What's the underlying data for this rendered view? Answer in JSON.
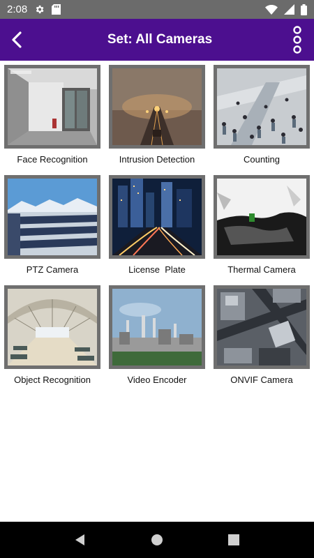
{
  "status_bar": {
    "time": "2:08",
    "icons": [
      "settings-gear-icon",
      "sd-card-icon",
      "wifi-icon",
      "signal-icon",
      "battery-icon"
    ]
  },
  "app_bar": {
    "title": "Set: All Cameras",
    "background_color": "#4c0f8f",
    "back_icon": "chevron-left-icon",
    "menu_icon": "three-dots-vertical-icon"
  },
  "cameras": [
    {
      "label": "Face Recognition",
      "image": "office-hallway-cctv"
    },
    {
      "label": "Intrusion Detection",
      "image": "foggy-street-night"
    },
    {
      "label": "Counting",
      "image": "crowded-escalators"
    },
    {
      "label": "PTZ Camera",
      "image": "solar-panels-mountains"
    },
    {
      "label": "License  Plate",
      "image": "city-highway-night"
    },
    {
      "label": "Thermal Camera",
      "image": "thermal-view"
    },
    {
      "label": "Object Recognition",
      "image": "airport-terminal"
    },
    {
      "label": "Video Encoder",
      "image": "industrial-skyline"
    },
    {
      "label": "ONVIF Camera",
      "image": "aerial-intersection"
    }
  ],
  "nav_bar": {
    "icons": [
      "back-triangle-icon",
      "home-circle-icon",
      "recents-square-icon"
    ]
  }
}
